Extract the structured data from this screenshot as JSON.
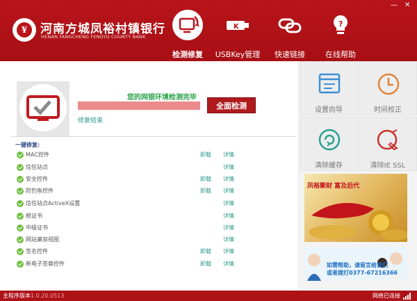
{
  "header": {
    "bank_name_cn": "河南方城凤裕村镇银行",
    "bank_name_en": "HENAN FANGCHENG FENGYU COUNTY BANK",
    "logo_glyph": "¥",
    "nav": [
      {
        "label": "检测修复",
        "icon": "monitor-repair-icon",
        "active": true
      },
      {
        "label": "USBKey管理",
        "icon": "usb-key-icon",
        "active": false
      },
      {
        "label": "快速链接",
        "icon": "link-icon",
        "active": false
      },
      {
        "label": "在线帮助",
        "icon": "lightbulb-help-icon",
        "active": false
      }
    ],
    "window_controls": {
      "minimize": "—",
      "close": "✕"
    }
  },
  "scan": {
    "status": "您的网银环境检测完毕",
    "progress": 1.0,
    "full_scan_button": "全面检测",
    "repair_link": "修复结束"
  },
  "checks": {
    "section_title": "一键修复:",
    "items": [
      {
        "name": "MAC控件",
        "uninstall": "卸载",
        "details": "详情"
      },
      {
        "name": "信任站点",
        "uninstall": "",
        "details": "详情"
      },
      {
        "name": "安全控件",
        "uninstall": "卸载",
        "details": "详情"
      },
      {
        "name": "防钓鱼控件",
        "uninstall": "卸载",
        "details": "详情"
      },
      {
        "name": "信任站点ActiveX设置",
        "uninstall": "",
        "details": "详情"
      },
      {
        "name": "根证书",
        "uninstall": "",
        "details": "详情"
      },
      {
        "name": "中级证书",
        "uninstall": "",
        "details": "详情"
      },
      {
        "name": "网站兼容视图",
        "uninstall": "",
        "details": "详情"
      },
      {
        "name": "签名控件",
        "uninstall": "卸载",
        "details": "详情"
      },
      {
        "name": "新电子签章控件",
        "uninstall": "卸载",
        "details": "详情"
      }
    ]
  },
  "tools": [
    {
      "label": "设置向导",
      "icon": "setup-wizard-icon"
    },
    {
      "label": "时间校正",
      "icon": "clock-icon"
    },
    {
      "label": "清除缓存",
      "icon": "clear-cache-icon"
    },
    {
      "label": "清除IE SSL",
      "icon": "broom-icon"
    }
  ],
  "ads": {
    "ad1_text": "凤裕聚财 富及后代",
    "ad2_line1": "如需帮助，请留言给我们",
    "ad2_line2": "或者拨打0377-67216366"
  },
  "footer": {
    "version_label": "主程序版本",
    "version": "1.0.20.0513",
    "network_status": "网络已连接"
  },
  "colors": {
    "brand_red": "#b8141a",
    "accent_teal": "#2a9a8a",
    "ok_green": "#6fbf3f",
    "status_green": "#2aa24a"
  }
}
